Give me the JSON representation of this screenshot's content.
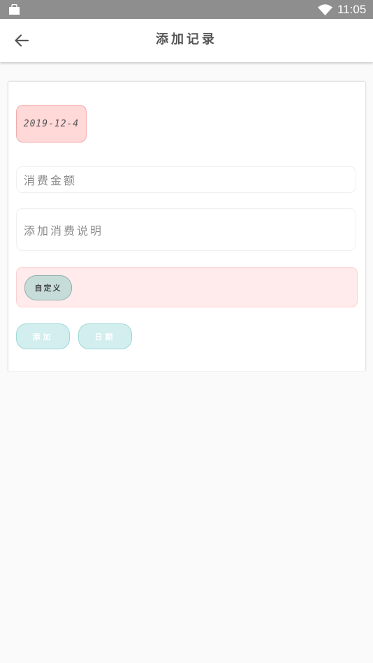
{
  "status_bar": {
    "time": "11:05",
    "icons": [
      "bag-icon",
      "wifi-icon"
    ]
  },
  "toolbar": {
    "title": "添加记录",
    "back_icon": "arrow-left-icon"
  },
  "form": {
    "date_value": "2019-12-4",
    "amount_placeholder": "消费金额",
    "note_placeholder": "添加消费说明",
    "category_label": "自定义",
    "add_button": "添加",
    "date_button": "日期"
  },
  "colors": {
    "status_bar": "#8e8e8e",
    "date_chip_bg": "#ffd8d8",
    "category_box_bg": "#ffebeb",
    "category_chip_bg": "#c6dcd8",
    "button_bg": "#d2eeee"
  }
}
